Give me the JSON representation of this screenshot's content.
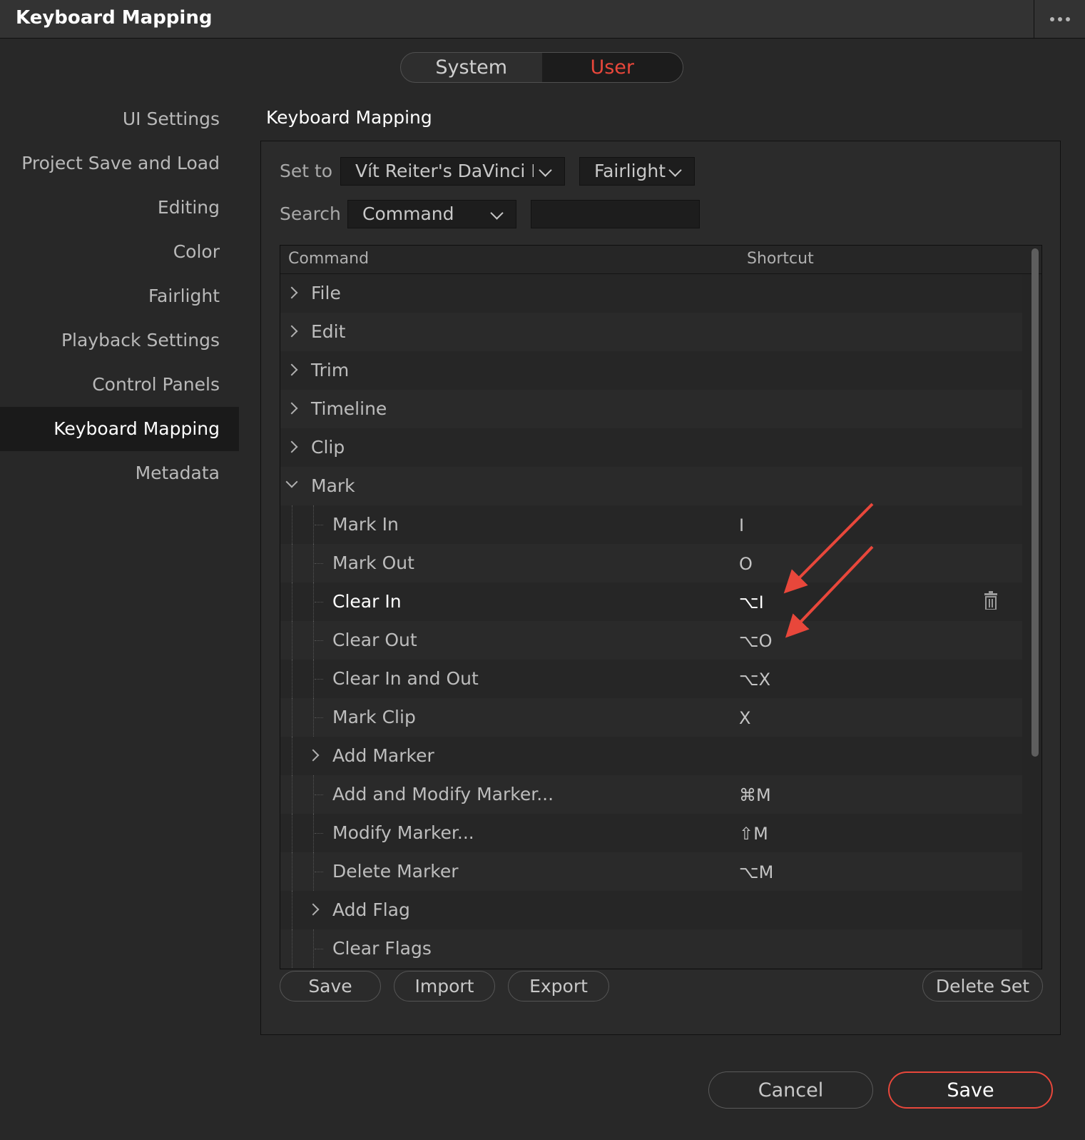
{
  "window": {
    "title": "Keyboard Mapping"
  },
  "segments": {
    "system": "System",
    "user": "User"
  },
  "sidebar": {
    "items": [
      {
        "label": "UI Settings"
      },
      {
        "label": "Project Save and Load"
      },
      {
        "label": "Editing"
      },
      {
        "label": "Color"
      },
      {
        "label": "Fairlight"
      },
      {
        "label": "Playback Settings"
      },
      {
        "label": "Control Panels"
      },
      {
        "label": "Keyboard Mapping",
        "active": true
      },
      {
        "label": "Metadata"
      }
    ]
  },
  "main": {
    "title": "Keyboard Mapping",
    "set_to_label": "Set to",
    "preset_value": "Vít Reiter's DaVinci Res",
    "layout_value": "Fairlight",
    "search_label": "Search",
    "search_field_value": "Command",
    "search_text_value": ""
  },
  "table": {
    "headers": {
      "command": "Command",
      "shortcut": "Shortcut"
    },
    "rows": [
      {
        "label": "File",
        "level": 0,
        "toggle": "collapsed",
        "shortcut": ""
      },
      {
        "label": "Edit",
        "level": 0,
        "toggle": "collapsed",
        "shortcut": ""
      },
      {
        "label": "Trim",
        "level": 0,
        "toggle": "collapsed",
        "shortcut": ""
      },
      {
        "label": "Timeline",
        "level": 0,
        "toggle": "collapsed",
        "shortcut": ""
      },
      {
        "label": "Clip",
        "level": 0,
        "toggle": "collapsed",
        "shortcut": ""
      },
      {
        "label": "Mark",
        "level": 0,
        "toggle": "expanded",
        "shortcut": ""
      },
      {
        "label": "Mark In",
        "level": 1,
        "toggle": "",
        "shortcut": "I"
      },
      {
        "label": "Mark Out",
        "level": 1,
        "toggle": "",
        "shortcut": "O"
      },
      {
        "label": "Clear In",
        "level": 1,
        "toggle": "",
        "shortcut": "⌥I",
        "selected": true
      },
      {
        "label": "Clear Out",
        "level": 1,
        "toggle": "",
        "shortcut": "⌥O"
      },
      {
        "label": "Clear In and Out",
        "level": 1,
        "toggle": "",
        "shortcut": "⌥X"
      },
      {
        "label": "Mark Clip",
        "level": 1,
        "toggle": "",
        "shortcut": "X"
      },
      {
        "label": "Add Marker",
        "level": 1,
        "toggle": "collapsed",
        "shortcut": ""
      },
      {
        "label": "Add and Modify Marker...",
        "level": 1,
        "toggle": "",
        "shortcut": "⌘M"
      },
      {
        "label": "Modify Marker...",
        "level": 1,
        "toggle": "",
        "shortcut": "⇧M"
      },
      {
        "label": "Delete Marker",
        "level": 1,
        "toggle": "",
        "shortcut": "⌥M"
      },
      {
        "label": "Add Flag",
        "level": 1,
        "toggle": "collapsed",
        "shortcut": ""
      },
      {
        "label": "Clear Flags",
        "level": 1,
        "toggle": "",
        "shortcut": ""
      }
    ]
  },
  "panel_buttons": {
    "save": "Save",
    "import": "Import",
    "export": "Export",
    "delete_set": "Delete Set"
  },
  "footer": {
    "cancel": "Cancel",
    "save": "Save"
  },
  "colors": {
    "accent": "#e8473b",
    "background": "#282828",
    "selected_sidebar": "#1a1a1a"
  },
  "icons": {
    "more": "more-dots-icon",
    "delete": "trash-icon",
    "annotation": "red-arrow-icon"
  }
}
